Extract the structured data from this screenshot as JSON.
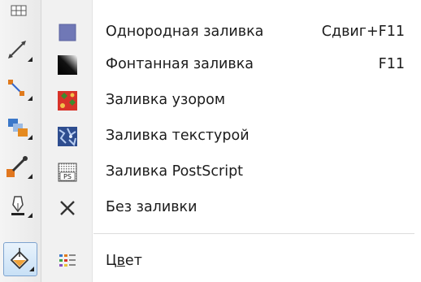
{
  "menu": {
    "items": [
      {
        "label": "Однородная заливка",
        "shortcut": "Сдвиг+F11",
        "icon": "uniform-fill-icon"
      },
      {
        "label": "Фонтанная заливка",
        "shortcut": "F11",
        "icon": "fountain-fill-icon"
      },
      {
        "label": "Заливка узором",
        "shortcut": "",
        "icon": "pattern-fill-icon"
      },
      {
        "label": "Заливка текстурой",
        "shortcut": "",
        "icon": "texture-fill-icon"
      },
      {
        "label": "Заливка PostScript",
        "shortcut": "",
        "icon": "postscript-fill-icon"
      },
      {
        "label": "Без заливки",
        "shortcut": "",
        "icon": "no-fill-icon"
      }
    ],
    "color_item": {
      "label_prefix": "Ц",
      "label_underlined": "в",
      "label_suffix": "ет",
      "icon": "color-docker-icon"
    }
  },
  "toolbox": {
    "tools": [
      "table-tool-icon",
      "dimension-tool-icon",
      "connector-tool-icon",
      "blend-tool-icon",
      "eyedropper-tool-icon",
      "outline-pen-tool-icon",
      "fill-tool-icon"
    ],
    "active": "fill-tool-icon"
  },
  "colors": {
    "uniform_fill": "#7078b6",
    "pattern_red": "#d8332a",
    "accent_border": "#7da2ce"
  },
  "postscript_icon_text": "PS"
}
